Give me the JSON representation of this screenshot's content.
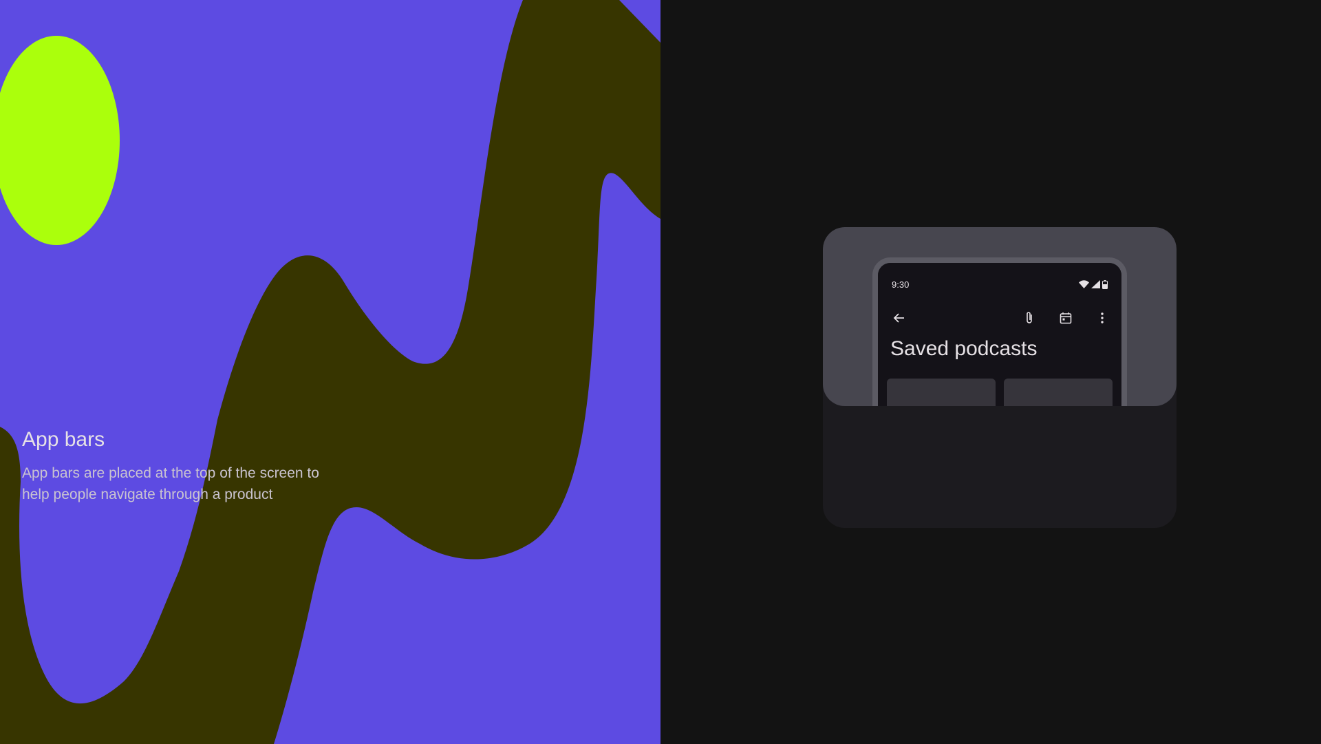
{
  "colors": {
    "art_background": "#5d4be2",
    "wave": "#373500",
    "blob": "#abff0c",
    "page_background": "#131313",
    "card_background": "#1c1b1f",
    "preview_background": "#47464f",
    "phone_frame": "#5c5b64",
    "phone_screen": "#141218",
    "tile": "#36343b",
    "text_primary": "#e6e1e5",
    "text_secondary": "#cac4d0"
  },
  "phone": {
    "status_time": "9:30",
    "status_icons": [
      "wifi-icon",
      "signal-icon",
      "battery-icon"
    ],
    "toolbar": {
      "navigation_icon": "arrow-back-icon",
      "action_icons": [
        "attach-icon",
        "calendar-icon",
        "more-vert-icon"
      ]
    },
    "screen_title": "Saved podcasts"
  },
  "card": {
    "title": "App bars",
    "description": "App bars are placed at the top of the screen to help people navigate through a product"
  }
}
